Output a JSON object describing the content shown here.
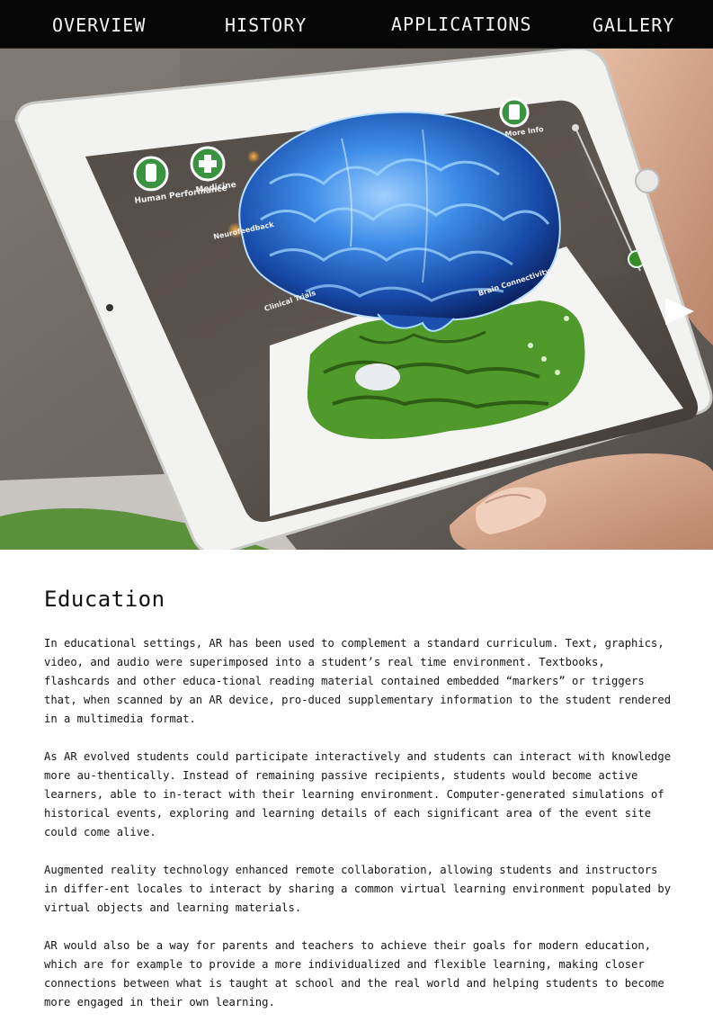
{
  "nav": {
    "items": [
      {
        "label": "OVERVIEW"
      },
      {
        "label": "HISTORY"
      },
      {
        "label": "APPLICATIONS"
      },
      {
        "label": "GALLERY"
      }
    ]
  },
  "hero": {
    "ui_labels": {
      "human_performance": "Human Performance",
      "medicine": "Medicine",
      "more_info": "More Info",
      "neuro_feedback": "Neurofeedback",
      "clinical_trials": "Clinical Trials",
      "brain_connectivity": "Brain Connectivity"
    },
    "next_icon": "play-triangle-icon"
  },
  "article": {
    "title": "Education",
    "paragraphs": [
      "In educational settings, AR has been used to complement a standard curriculum. Text, graphics, video, and audio were superimposed into a student’s real time environment. Textbooks, flashcards and other educa-tional reading material contained embedded “markers” or triggers that, when scanned by an AR device, pro-duced supplementary information to the student rendered in a multimedia format.",
      "As AR evolved students could participate interactively and students can interact with knowledge more au-thentically. Instead of remaining passive recipients, students would become active learners, able to in-teract with their learning environment. Computer-generated simulations of historical events, exploring and learning details of each significant area of the event site could come alive.",
      "Augmented reality technology enhanced remote collaboration, allowing students and instructors in differ-ent locales to interact by sharing a common virtual learning environment populated by virtual objects and learning materials.",
      "AR would also be a way for parents and teachers to achieve their goals for modern education, which are for example to provide a more individualized and flexible learning, making closer connections between what is taught at school and the real world and helping students to become more engaged in their own learning."
    ]
  },
  "colors": {
    "nav_bg": "#060606",
    "nav_text": "#f2f2f2",
    "brain_blue": "#2e7be0",
    "print_green": "#4f9a2a"
  }
}
